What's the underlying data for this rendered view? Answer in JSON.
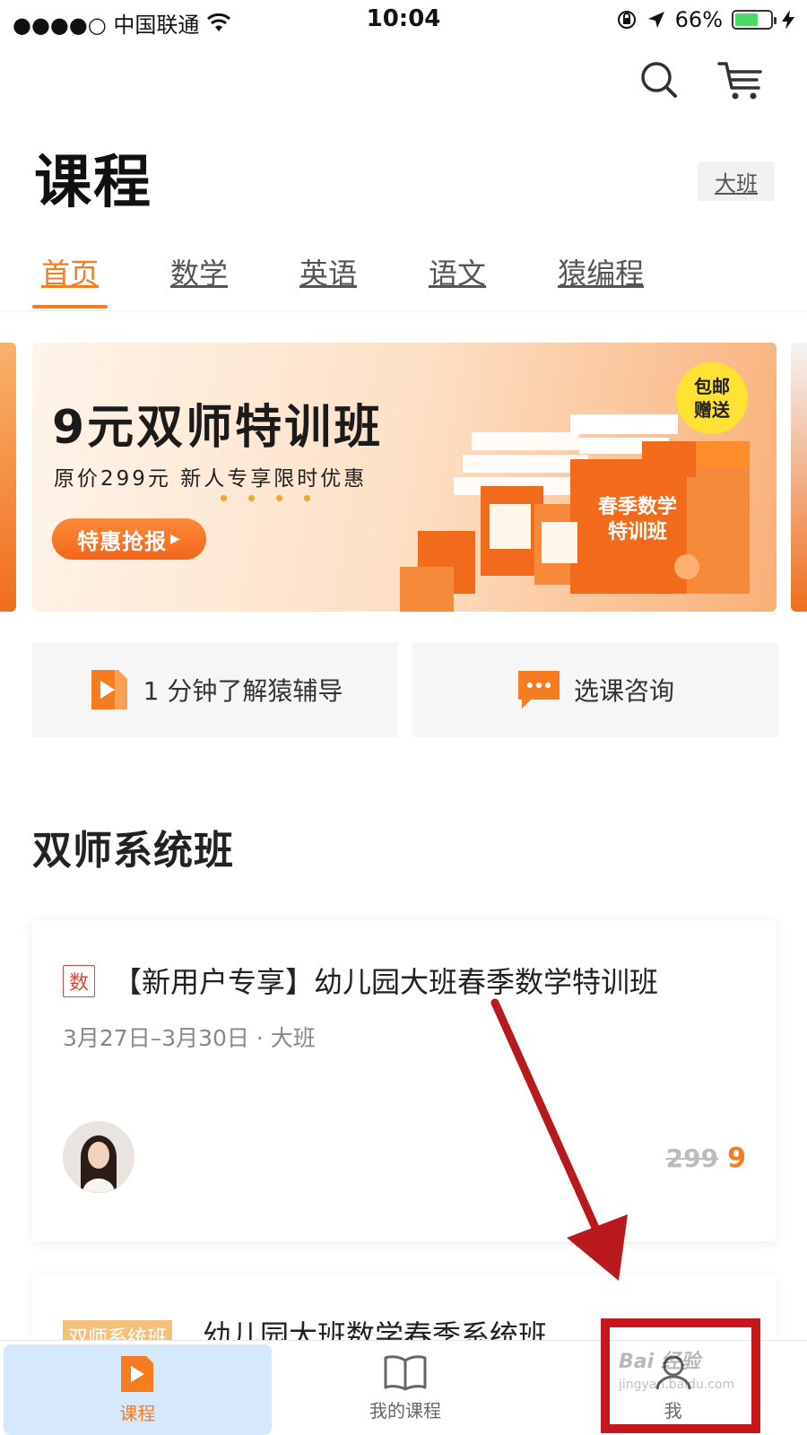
{
  "status_bar": {
    "carrier": "●●●●○ 中国联通",
    "time": "10:04",
    "battery": "66%",
    "battery_level": 0.66
  },
  "header": {
    "title": "课程",
    "grade_button": "大班"
  },
  "tabs": [
    {
      "label": "首页",
      "active": true
    },
    {
      "label": "数学",
      "active": false
    },
    {
      "label": "英语",
      "active": false
    },
    {
      "label": "语文",
      "active": false
    },
    {
      "label": "猿编程",
      "active": false
    }
  ],
  "banner": {
    "title": "9元双师特训班",
    "subtitle": "原价299元 新人专享限时优惠",
    "cta": "特惠抢报",
    "badge_line1": "包邮",
    "badge_line2": "赠送",
    "box_label_line1": "春季数学",
    "box_label_line2": "特训班"
  },
  "quick_actions": [
    {
      "label": "1 分钟了解猿辅导",
      "icon": "play-video-icon"
    },
    {
      "label": "选课咨询",
      "icon": "chat-bubble-icon"
    }
  ],
  "section": {
    "title": "双师系统班"
  },
  "course_card": {
    "subject_tag": "数",
    "title": "【新用户专享】幼儿园大班春季数学特训班",
    "meta": "3月27日–3月30日 · 大班",
    "original_price": "299",
    "price": "9"
  },
  "course_card_2": {
    "tag": "双师系统班",
    "title": "幼儿园大班数学春季系统班"
  },
  "tabbar": [
    {
      "label": "课程",
      "icon": "play-course-icon",
      "active": true
    },
    {
      "label": "我的课程",
      "icon": "book-icon",
      "active": false
    },
    {
      "label": "我",
      "icon": "profile-icon",
      "active": false
    }
  ],
  "watermark": {
    "text": "Bai 经验",
    "url": "jingyan.baidu.com"
  },
  "colors": {
    "accent": "#f57c1f",
    "annotation_red": "#c4181c",
    "tag_red": "#e0453a"
  }
}
